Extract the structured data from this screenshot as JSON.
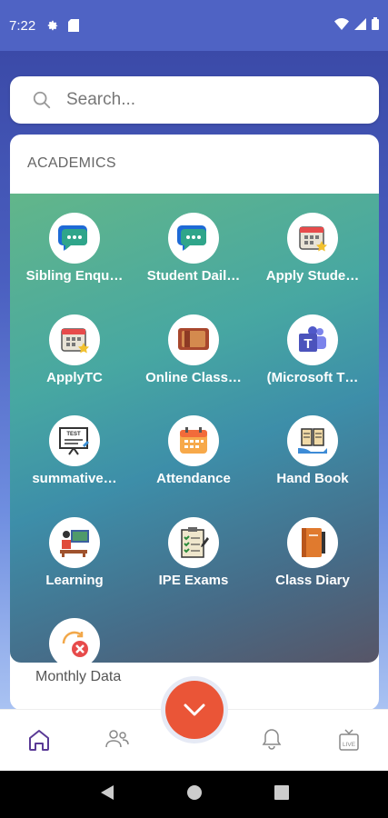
{
  "status_bar": {
    "time": "7:22",
    "icons": [
      "gear-icon",
      "sd-card-icon",
      "wifi-icon",
      "signal-icon",
      "battery-icon"
    ]
  },
  "search": {
    "placeholder": "Search...",
    "icon": "search-icon"
  },
  "section": {
    "title": "ACADEMICS",
    "items": [
      {
        "label": "Sibling Enqu…",
        "icon": "chat-bubble-icon"
      },
      {
        "label": "Student Dail…",
        "icon": "chat-bubble-icon"
      },
      {
        "label": "Apply Stude…",
        "icon": "calendar-star-icon"
      },
      {
        "label": "ApplyTC",
        "icon": "calendar-star-icon"
      },
      {
        "label": "Online Class…",
        "icon": "video-screen-icon"
      },
      {
        "label": "(Microsoft T…",
        "icon": "microsoft-teams-icon"
      },
      {
        "label": "summative…",
        "icon": "test-board-icon"
      },
      {
        "label": "Attendance",
        "icon": "calendar-icon"
      },
      {
        "label": "Hand Book",
        "icon": "book-hand-icon"
      },
      {
        "label": "Learning",
        "icon": "teacher-board-icon"
      },
      {
        "label": "IPE Exams",
        "icon": "exam-checklist-icon"
      },
      {
        "label": "Class Diary",
        "icon": "diary-icon"
      },
      {
        "label": "",
        "icon": "monthly-data-icon"
      }
    ]
  },
  "below_item_label": "Monthly Data",
  "bottom_nav": {
    "items": [
      "home-icon",
      "people-icon",
      "bell-icon",
      "live-tv-icon"
    ],
    "fab_icon": "chevron-down-icon"
  },
  "colors": {
    "primary": "#4f63c4",
    "fab": "#ea5537",
    "active_nav": "#5a3a96"
  }
}
